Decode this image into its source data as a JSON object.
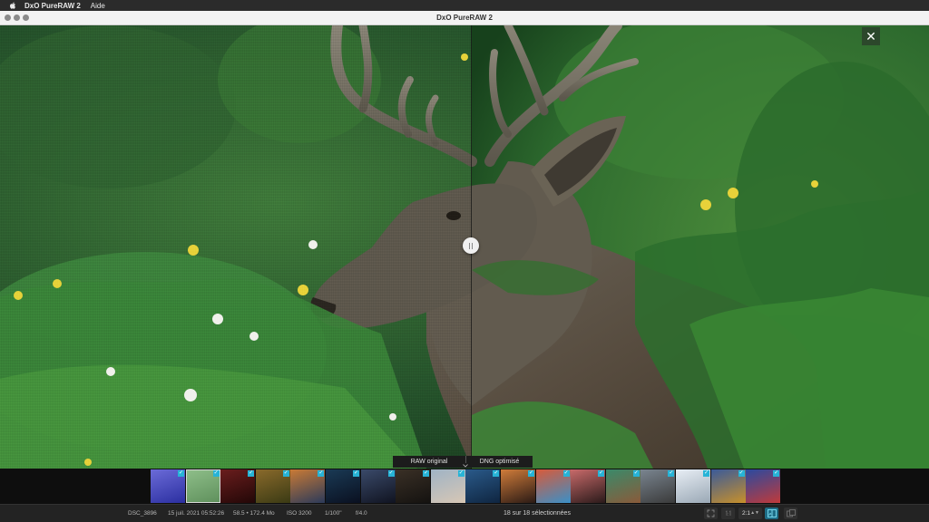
{
  "menubar": {
    "app_name": "DxO PureRAW 2",
    "help_menu": "Aide"
  },
  "window": {
    "title": "DxO PureRAW 2"
  },
  "viewer": {
    "close_glyph": "✕",
    "compare": {
      "left_label": "RAW original",
      "right_label": "DNG optimisé"
    }
  },
  "filmstrip": {
    "thumbnails": [
      {
        "colors": [
          "#6b6bd8",
          "#2b2fa0"
        ],
        "checked": true,
        "selected": false
      },
      {
        "colors": [
          "#8fbf8a",
          "#5e8f5b"
        ],
        "checked": true,
        "selected": true
      },
      {
        "colors": [
          "#6a1d1d",
          "#220707"
        ],
        "checked": true,
        "selected": false
      },
      {
        "colors": [
          "#8a6a2b",
          "#3a3a14"
        ],
        "checked": true,
        "selected": false
      },
      {
        "colors": [
          "#c97a35",
          "#2b3a5a"
        ],
        "checked": true,
        "selected": false
      },
      {
        "colors": [
          "#1a3a55",
          "#0a1020"
        ],
        "checked": true,
        "selected": false
      },
      {
        "colors": [
          "#3a4a6a",
          "#101320"
        ],
        "checked": true,
        "selected": false
      },
      {
        "colors": [
          "#3a3026",
          "#141210"
        ],
        "checked": true,
        "selected": false
      },
      {
        "colors": [
          "#9fb3c5",
          "#d7c7b5"
        ],
        "checked": true,
        "selected": false
      },
      {
        "colors": [
          "#2a5a8a",
          "#0f2540"
        ],
        "checked": true,
        "selected": false
      },
      {
        "colors": [
          "#d07c3a",
          "#2a1a15"
        ],
        "checked": true,
        "selected": false
      },
      {
        "colors": [
          "#d85a3a",
          "#3a90c8"
        ],
        "checked": true,
        "selected": false
      },
      {
        "colors": [
          "#c86a6a",
          "#2a1a1a"
        ],
        "checked": true,
        "selected": false
      },
      {
        "colors": [
          "#3a8a6a",
          "#8a5a3a"
        ],
        "checked": true,
        "selected": false
      },
      {
        "colors": [
          "#7a8590",
          "#3a3a3a"
        ],
        "checked": true,
        "selected": false
      },
      {
        "colors": [
          "#e8eef5",
          "#9aa8b5"
        ],
        "checked": true,
        "selected": false
      },
      {
        "colors": [
          "#3a5a9a",
          "#c8902a"
        ],
        "checked": true,
        "selected": false
      },
      {
        "colors": [
          "#2a4aa0",
          "#c03a3a"
        ],
        "checked": true,
        "selected": false
      }
    ]
  },
  "status": {
    "filename": "DSC_3896",
    "date": "15 juil. 2021 05:52:26",
    "size": "58.5 • 172.4 Mo",
    "iso": "ISO 3200",
    "shutter": "1/100\"",
    "aperture": "f/4.0",
    "selection": "18 sur 18 sélectionnées",
    "zoom_value": "2:1",
    "zoom_arrows": "▲▼",
    "check_glyph": "✓"
  },
  "colors": {
    "accent": "#27b3d6",
    "foliage": "#2e5a2c"
  }
}
